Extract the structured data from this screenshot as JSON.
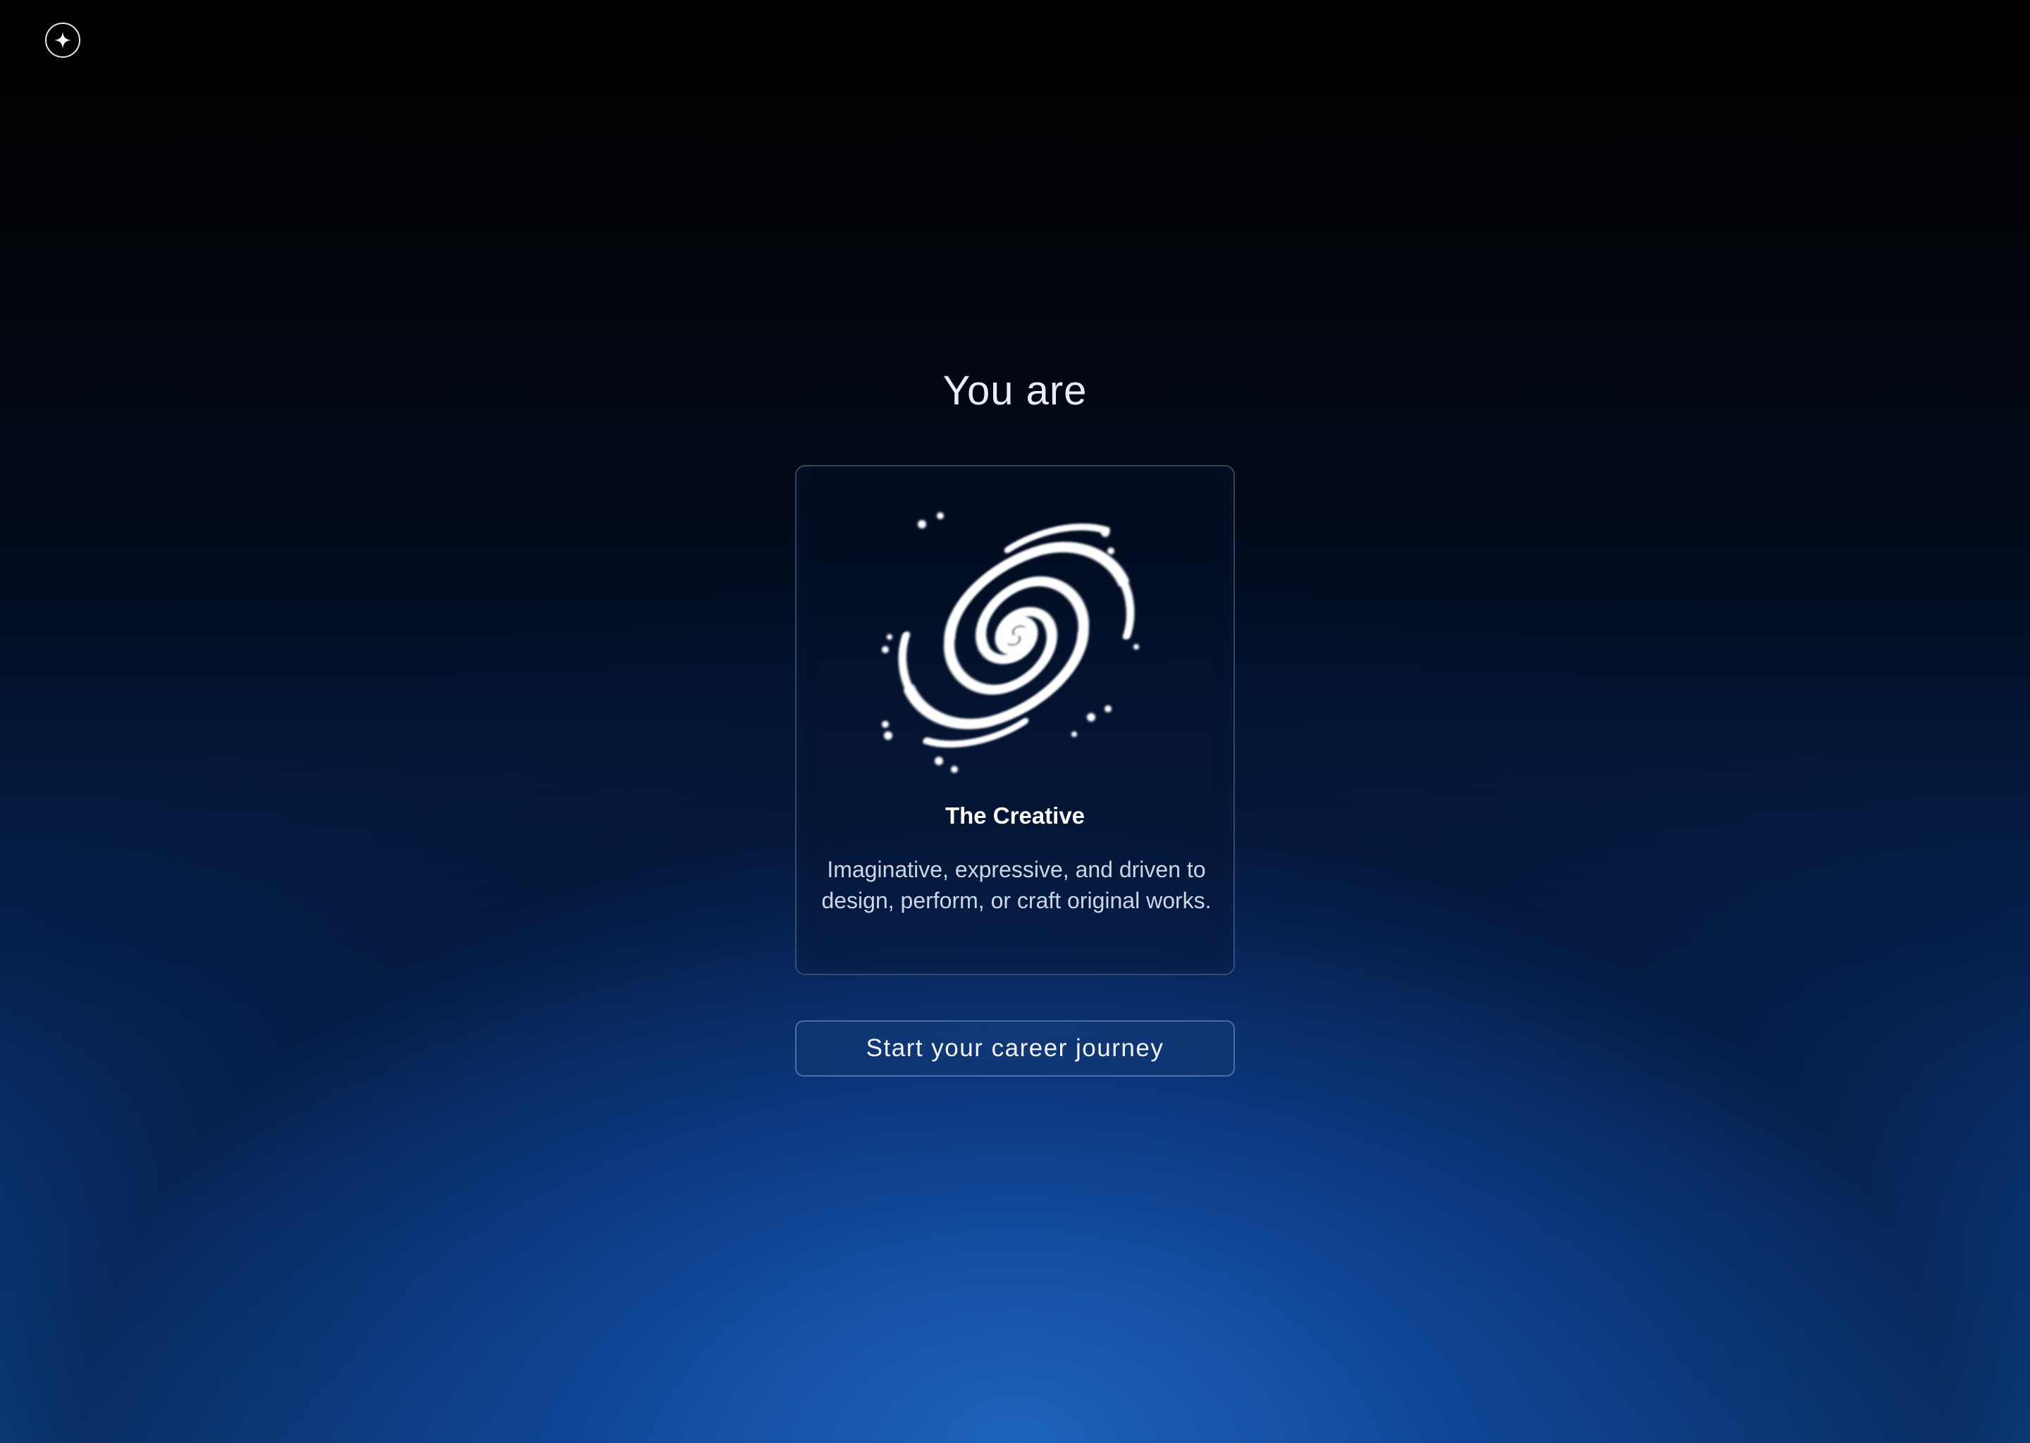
{
  "header": {
    "logo_icon": "sparkle-star-icon"
  },
  "main": {
    "heading": "You are",
    "result_card": {
      "illustration_icon": "spiral-galaxy-icon",
      "title": "The Creative",
      "description": "Imaginative, expressive, and driven to design, perform, or craft original works."
    },
    "cta_label": "Start your career journey"
  },
  "colors": {
    "accent": "#1459ad",
    "background_top": "#000000",
    "text_primary": "#ffffff",
    "text_secondary": "#cdd6e4"
  }
}
